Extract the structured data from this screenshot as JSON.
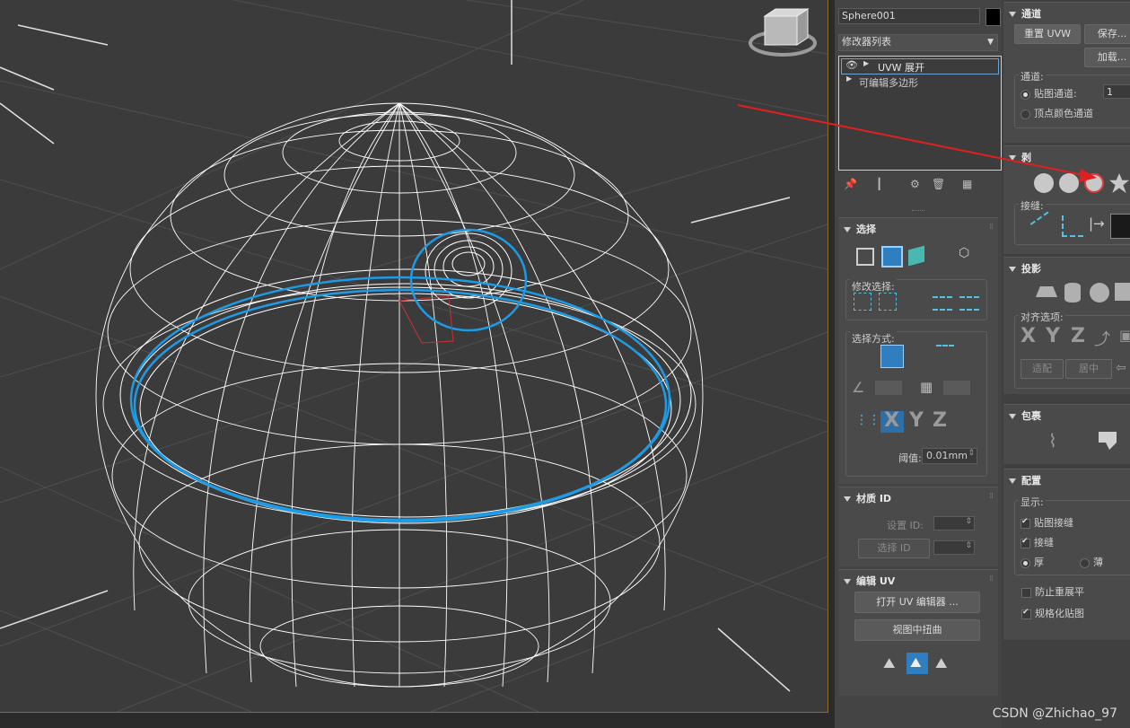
{
  "object": {
    "name": "Sphere001",
    "color": "#000000"
  },
  "modifier_list": {
    "label": "修改器列表",
    "items": [
      "UVW 展开",
      "可编辑多边形"
    ]
  },
  "selection_rollout": {
    "title": "选择",
    "modify_selection_label": "修改选择:",
    "select_by_label": "选择方式:",
    "threshold_label": "阈值:",
    "threshold_value": "0.01mm",
    "axes": [
      "X",
      "Y",
      "Z"
    ]
  },
  "material_id_rollout": {
    "title": "材质 ID",
    "set_id_label": "设置 ID:",
    "select_id_label": "选择 ID"
  },
  "edit_uv_rollout": {
    "title": "编辑 UV",
    "open_editor": "打开 UV 编辑器 ...",
    "tweak_in_view": "视图中扭曲"
  },
  "channel_rollout": {
    "title": "通道",
    "reset_uvw": "重置 UVW",
    "save": "保存...",
    "load": "加载...",
    "channel_group": "通道:",
    "map_channel": "贴图通道:",
    "map_channel_value": "1",
    "vertex_color_channel": "顶点颜色通道"
  },
  "peel_rollout": {
    "title": "剥",
    "seams_label": "接缝:"
  },
  "projection_rollout": {
    "title": "投影",
    "align_options": "对齐选项:",
    "axes": [
      "X",
      "Y",
      "Z"
    ],
    "fit": "适配",
    "center": "居中"
  },
  "wrap_rollout": {
    "title": "包裹"
  },
  "config_rollout": {
    "title": "配置",
    "display_label": "显示:",
    "map_seams": "贴图接缝",
    "seams": "接缝",
    "thick": "厚",
    "thin": "薄",
    "prevent_reflatten": "防止重展平",
    "normalize_map": "规格化贴图"
  },
  "watermark": "CSDN @Zhichao_97",
  "colors": {
    "accent": "#1e9be6",
    "annotation_arrow": "#e02020",
    "wire": "#ffffff"
  }
}
